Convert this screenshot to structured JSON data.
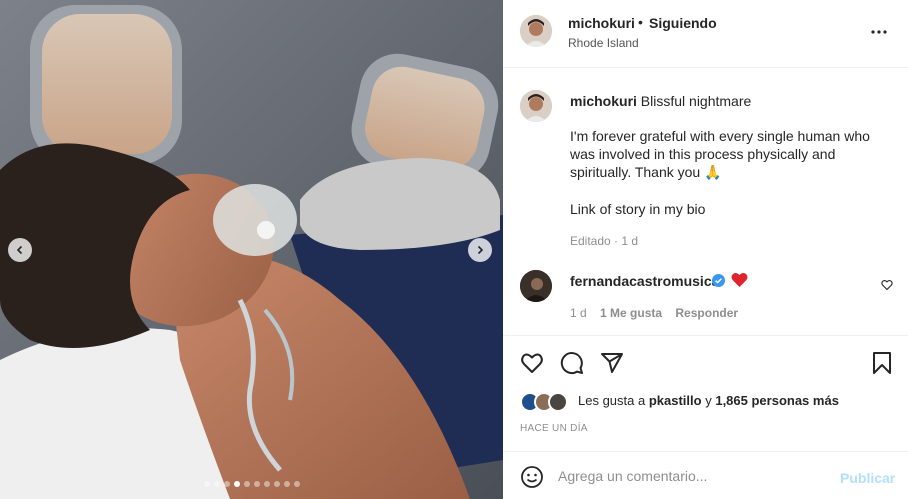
{
  "post": {
    "username": "michokuri",
    "separator": "•",
    "follow_status": "Siguiendo",
    "location": "Rhode Island",
    "more_icon": "more-horizontal-icon",
    "slides_count": 10,
    "active_slide_index": 3
  },
  "caption": {
    "username": "michokuri",
    "title": "Blissful nightmare",
    "body": "I'm forever grateful with every single human who was involved in this process physically and spiritually. Thank you 🙏",
    "bio_note": "Link of story in my bio",
    "edited": "Editado",
    "time_sep": "·",
    "age": "1 d"
  },
  "reply": {
    "username": "fernandacastromusica",
    "emoji": "❤️",
    "age": "1 d",
    "likes": "1 Me gusta",
    "reply_label": "Responder"
  },
  "actions": {
    "like_icon": "heart-outline-icon",
    "comment_icon": "comment-icon",
    "share_icon": "paper-plane-icon",
    "save_icon": "bookmark-icon"
  },
  "likes": {
    "prefix": "Les gusta a",
    "user": "pkastillo",
    "connector": "y",
    "count": "1,865 personas más"
  },
  "timestamp": "HACE UN DÍA",
  "comment": {
    "placeholder": "Agrega un comentario...",
    "post_label": "Publicar"
  },
  "colors": {
    "verified": "#3897f0",
    "publish_disabled": "#b2dffc",
    "meta_text": "#8e8e8e",
    "heart_red": "#ed4956"
  }
}
